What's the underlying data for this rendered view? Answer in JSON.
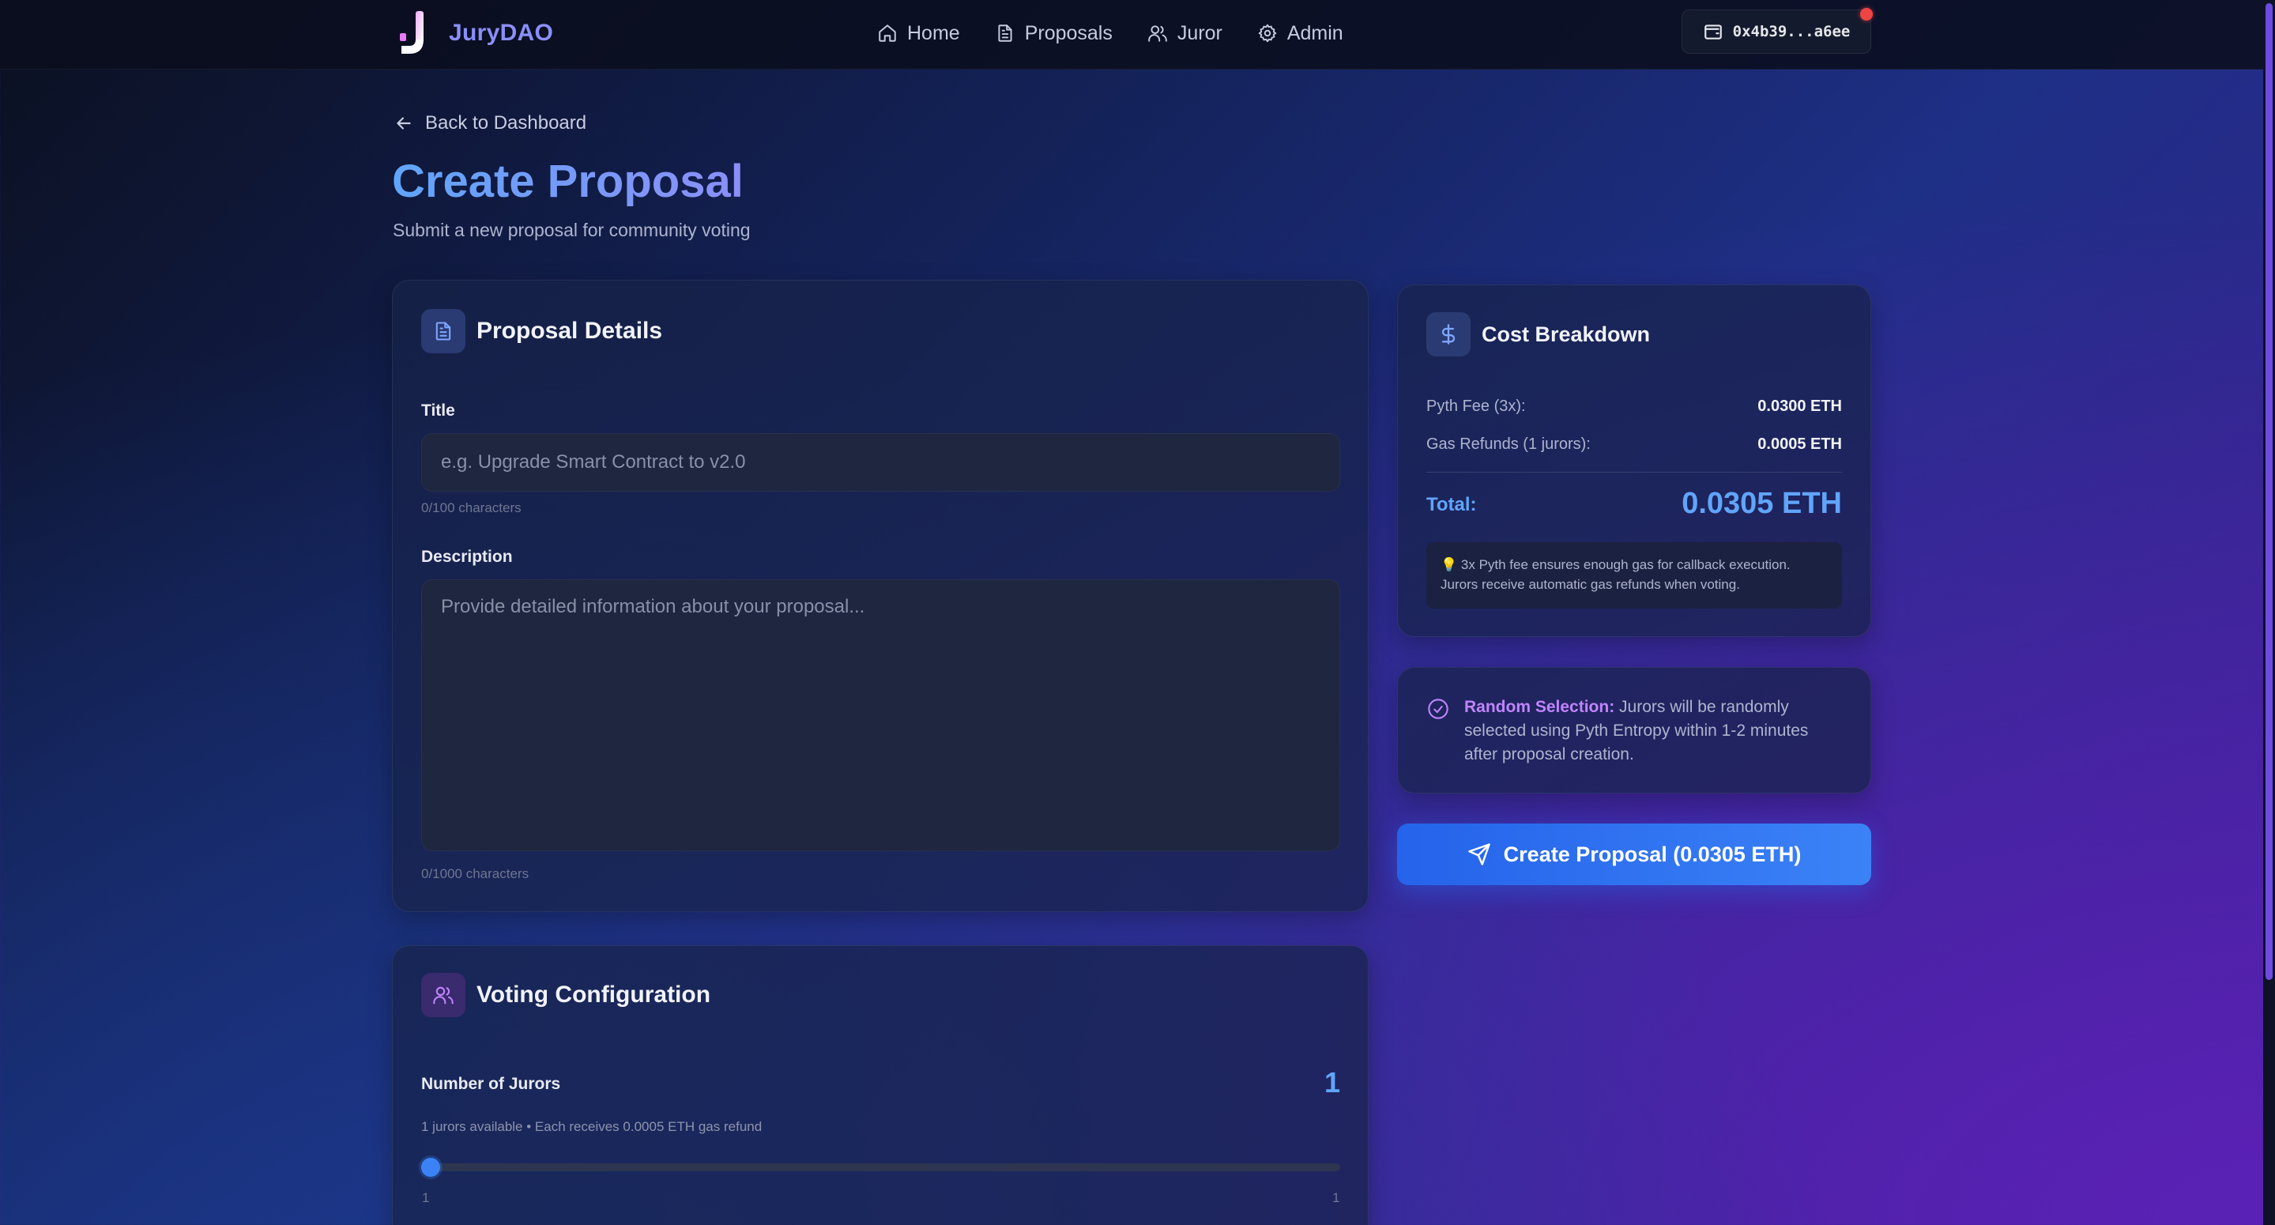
{
  "nav": {
    "brand": "JuryDAO",
    "links": [
      {
        "label": "Home",
        "icon": "home-icon"
      },
      {
        "label": "Proposals",
        "icon": "document-icon"
      },
      {
        "label": "Juror",
        "icon": "users-icon"
      },
      {
        "label": "Admin",
        "icon": "gear-icon"
      }
    ],
    "wallet": "0x4b39...a6ee"
  },
  "header": {
    "back": "Back to Dashboard",
    "title": "Create Proposal",
    "subtitle": "Submit a new proposal for community voting"
  },
  "details": {
    "heading": "Proposal Details",
    "title_label": "Title",
    "title_placeholder": "e.g. Upgrade Smart Contract to v2.0",
    "title_value": "",
    "title_count": "0/100 characters",
    "desc_label": "Description",
    "desc_placeholder": "Provide detailed information about your proposal...",
    "desc_value": "",
    "desc_count": "0/1000 characters"
  },
  "voting": {
    "heading": "Voting Configuration",
    "jurors_label": "Number of Jurors",
    "jurors_value": "1",
    "jurors_hint": "1 jurors available • Each receives 0.0005 ETH gas refund",
    "slider_min": "1",
    "slider_max": "1"
  },
  "cost": {
    "heading": "Cost Breakdown",
    "rows": [
      {
        "label": "Pyth Fee (3x):",
        "value": "0.0300 ETH"
      },
      {
        "label": "Gas Refunds (1 jurors):",
        "value": "0.0005 ETH"
      }
    ],
    "total_label": "Total:",
    "total_value": "0.0305 ETH",
    "note": "💡 3x Pyth fee ensures enough gas for callback execution. Jurors receive automatic gas refunds when voting."
  },
  "info": {
    "strong": "Random Selection:",
    "text": " Jurors will be randomly selected using Pyth Entropy within 1-2 minutes after proposal creation."
  },
  "cta": {
    "label": "Create Proposal (0.0305 ETH)"
  },
  "colors": {
    "accent": "#3b82f6",
    "brand": "#8b8ff7",
    "highlight": "#c084fc"
  }
}
